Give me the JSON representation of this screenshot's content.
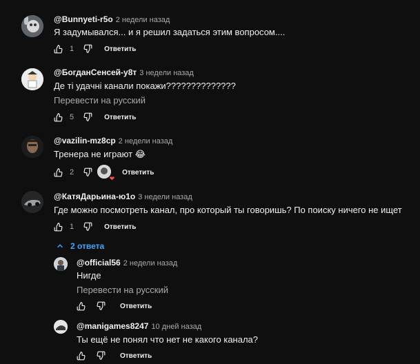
{
  "comments": [
    {
      "handle": "@Bunnyeti-r5o",
      "time": "2 недели назад",
      "text": "Я задумывался... и я решил задаться этим вопросом....",
      "likes": "1",
      "reply": "Ответить"
    },
    {
      "handle": "@БогданСенсей-у8т",
      "time": "3 недели назад",
      "text": "Де ті удачні канали покажи??????????????",
      "translate": "Перевести на русский",
      "likes": "5",
      "reply": "Ответить"
    },
    {
      "handle": "@vazilin-mz8cp",
      "time": "2 недели назад",
      "text": "Тренера не играют",
      "emoji": "😂",
      "likes": "2",
      "reply": "Ответить"
    },
    {
      "handle": "@КатяДарьина-ю1о",
      "time": "3 недели назад",
      "text": "Где можно посмотреть канал, про который ты говоришь? По поиску ничего не ищет",
      "likes": "1",
      "reply": "Ответить"
    }
  ],
  "replies_toggle": "2 ответа",
  "replies": [
    {
      "handle": "@official56",
      "time": "2 недели назад",
      "text": "Нигде",
      "translate": "Перевести на русский",
      "reply": "Ответить"
    },
    {
      "handle": "@manigames8247",
      "time": "10 дней назад",
      "text": "Ты ещё не понял что нет не какого канала?",
      "reply": "Ответить"
    }
  ],
  "colors": {
    "background": "#0f0f0f",
    "text": "#f1f1f1",
    "secondary": "#aaaaaa",
    "link": "#3ea6ff",
    "heart": "#ff4e45"
  }
}
